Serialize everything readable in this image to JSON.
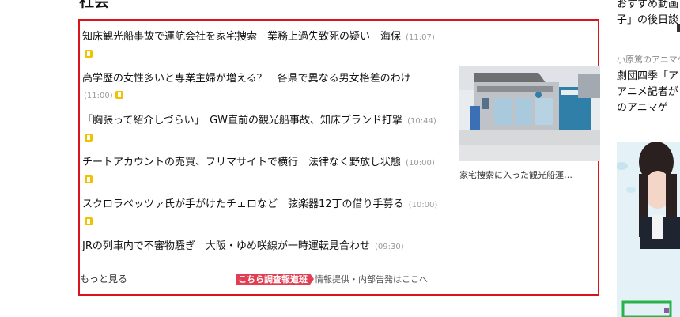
{
  "section": {
    "title": "社会"
  },
  "news": [
    {
      "headline": "知床観光船事故で運航会社を家宅捜索　業務上過失致死の疑い　海保",
      "time": "(11:07)",
      "badge": true
    },
    {
      "headline": "高学歴の女性多いと専業主婦が増える？　各県で異なる男女格差のわけ",
      "time": "(11:00)",
      "badge": true
    },
    {
      "headline": "「胸張って紹介しづらい」　GW直前の観光船事故、知床ブランド打撃",
      "time": "(10:44)",
      "badge": true
    },
    {
      "headline": "チートアカウントの売買、フリマサイトで横行　法律なく野放し状態",
      "time": "(10:00)",
      "badge": true
    },
    {
      "headline": "スクロラベッツァ氏が手がけたチェロなど　弦楽器12丁の借り手募る",
      "time": "(10:00)",
      "badge": true
    },
    {
      "headline": "JRの列車内で不審物騒ぎ　大阪・ゆめ咲線が一時運転見合わせ",
      "time": "(09:30)",
      "badge": false
    }
  ],
  "photo": {
    "caption": "家宅捜索に入った観光船運…"
  },
  "more": {
    "label": "もっと見る"
  },
  "tip": {
    "badge": "こちら調査報道班",
    "text": "情報提供・内部告発はここへ"
  },
  "sidebar": {
    "lines": [
      "おすすめ動画",
      "子」の後日談"
    ],
    "category": "小原篤のアニマゲ",
    "article_lines": [
      "劇団四季「ア",
      "アニメ記者が",
      "のアニマゲ"
    ]
  },
  "colors": {
    "box_border": "#d9141b",
    "badge": "#f2c200",
    "tip_badge": "#e03e52"
  }
}
